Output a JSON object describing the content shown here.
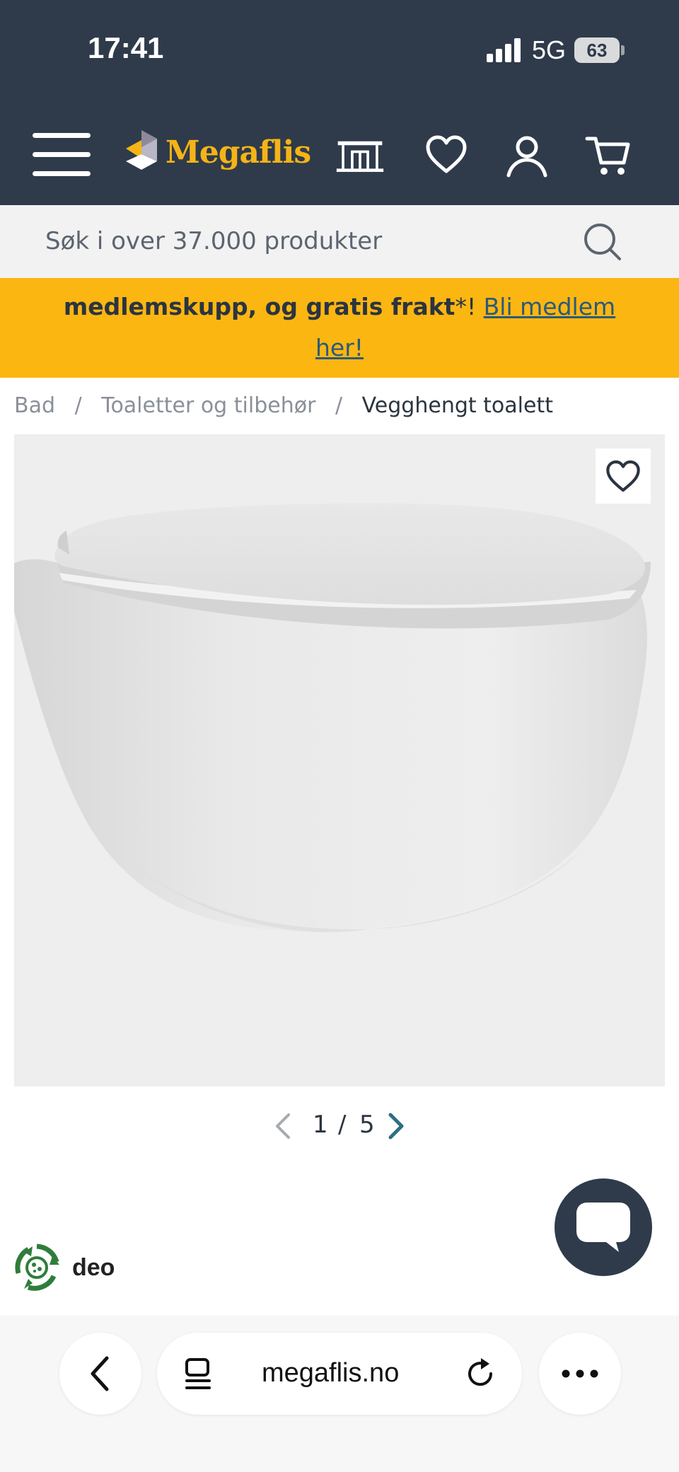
{
  "status_bar": {
    "time": "17:41",
    "network": "5G",
    "battery": "63"
  },
  "header": {
    "logo_text": "Megaflis"
  },
  "search": {
    "placeholder": "Søk i over 37.000 produkter"
  },
  "promo": {
    "text_bold": "medlemskupp, og gratis frakt",
    "asterisk": "*",
    "exclaim": "! ",
    "link_text": "Bli medlem her!"
  },
  "breadcrumb": {
    "items": [
      "Bad",
      "Toaletter og tilbehør"
    ],
    "separator": "/",
    "current": "Vegghengt toalett"
  },
  "gallery": {
    "current": "1",
    "separator": "/",
    "total": "5"
  },
  "deo": {
    "label": "deo"
  },
  "browser": {
    "url": "megaflis.no"
  },
  "colors": {
    "navy": "#2f3b4b",
    "accent_yellow": "#fbb612",
    "logo_yellow": "#f5b416",
    "link": "#2b5a7a"
  }
}
